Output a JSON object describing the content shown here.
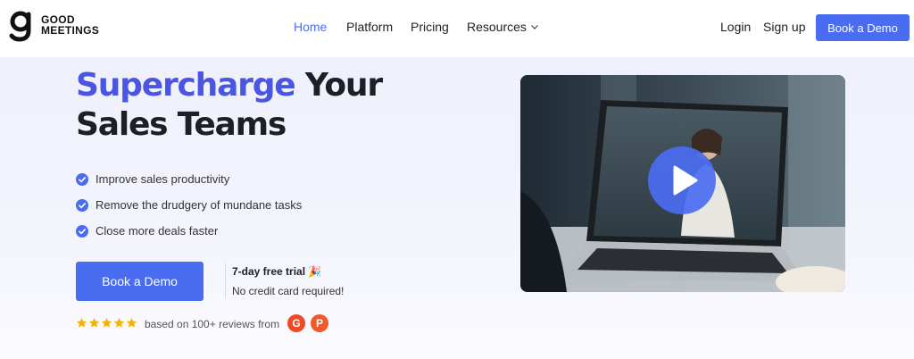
{
  "brand": {
    "logo_line1": "GOOD",
    "logo_line2": "MEETINGS"
  },
  "nav": {
    "home": "Home",
    "platform": "Platform",
    "pricing": "Pricing",
    "resources": "Resources"
  },
  "header_actions": {
    "login": "Login",
    "signup": "Sign up",
    "book_demo": "Book a Demo"
  },
  "hero": {
    "title_accent": "Supercharge",
    "title_rest_line1": " Your",
    "title_line2": "Sales Teams",
    "bullets": [
      "Improve sales productivity",
      "Remove the drudgery of mundane tasks",
      "Close more deals faster"
    ],
    "cta": "Book a Demo",
    "trial": "7-day free trial 🎉",
    "no_card": "No credit card required!",
    "rating_stars": 5,
    "reviews_text": "based on 100+ reviews from",
    "badge_g2": "G",
    "badge_p": "P"
  },
  "colors": {
    "accent": "#4a6cf0",
    "title_accent": "#4a56e2",
    "star": "#f5b301",
    "badge": "#ef4a25"
  },
  "icons": {
    "bullet": "check-circle-icon",
    "play": "play-icon",
    "dropdown": "chevron-down-icon"
  }
}
